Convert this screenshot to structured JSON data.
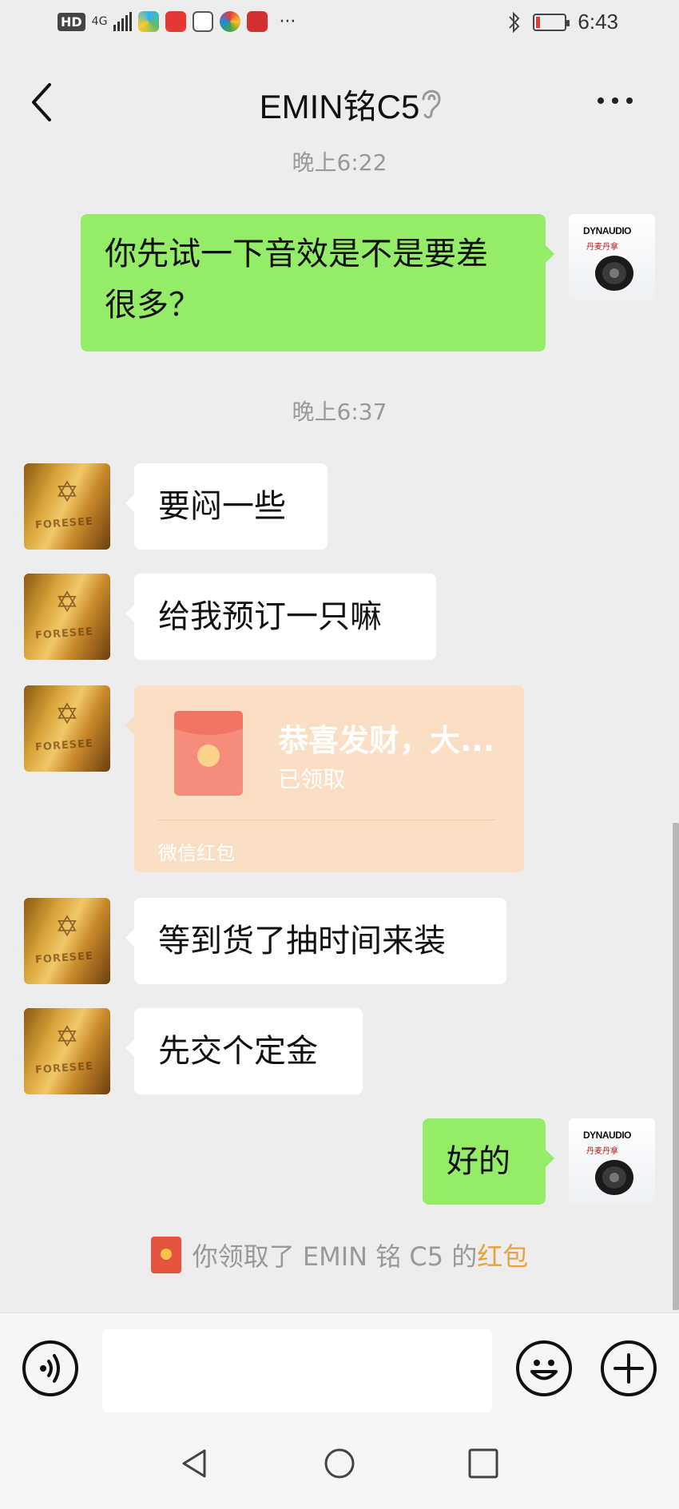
{
  "status_bar": {
    "network_label": "HD",
    "network_type": "4G",
    "more_indicator": "···",
    "time": "6:43",
    "battery_level_percent": 8
  },
  "header": {
    "title": "EMIN铭C5",
    "back_icon": "chevron-left-icon",
    "mode_icon": "ear-icon",
    "more_icon": "more-dots-icon"
  },
  "messages": {
    "ts1": "晚上6:22",
    "m1": "你先试一下音效是不是要差",
    "m1b": "很多？",
    "ts2": "晚上6:37",
    "m2": "要闷一些",
    "m3": "给我预订一只嘛",
    "redpacket": {
      "title": "恭喜发财，大...",
      "status": "已领取",
      "footer": "微信红包",
      "symbol": "¥"
    },
    "m4": "等到货了抽时间来装",
    "m5": "先交个定金",
    "m6": "好的"
  },
  "avatars": {
    "contact_brand": "FORESEE",
    "contact_emblem": "✡",
    "self_brand": "DYNAUDIO",
    "self_sub": "丹麦丹拿"
  },
  "system_message": {
    "prefix": "你领取了 EMIN 铭 C5 的",
    "link": "红包"
  },
  "input_bar": {
    "voice_icon": "voice-icon",
    "emoji_icon": "emoji-icon",
    "plus_icon": "plus-icon",
    "placeholder": ""
  },
  "colors": {
    "background": "#ededed",
    "outgoing_bubble": "#95ec69",
    "incoming_bubble": "#ffffff",
    "redpacket_bg": "#fbdfc4",
    "link": "#e8a33e"
  }
}
